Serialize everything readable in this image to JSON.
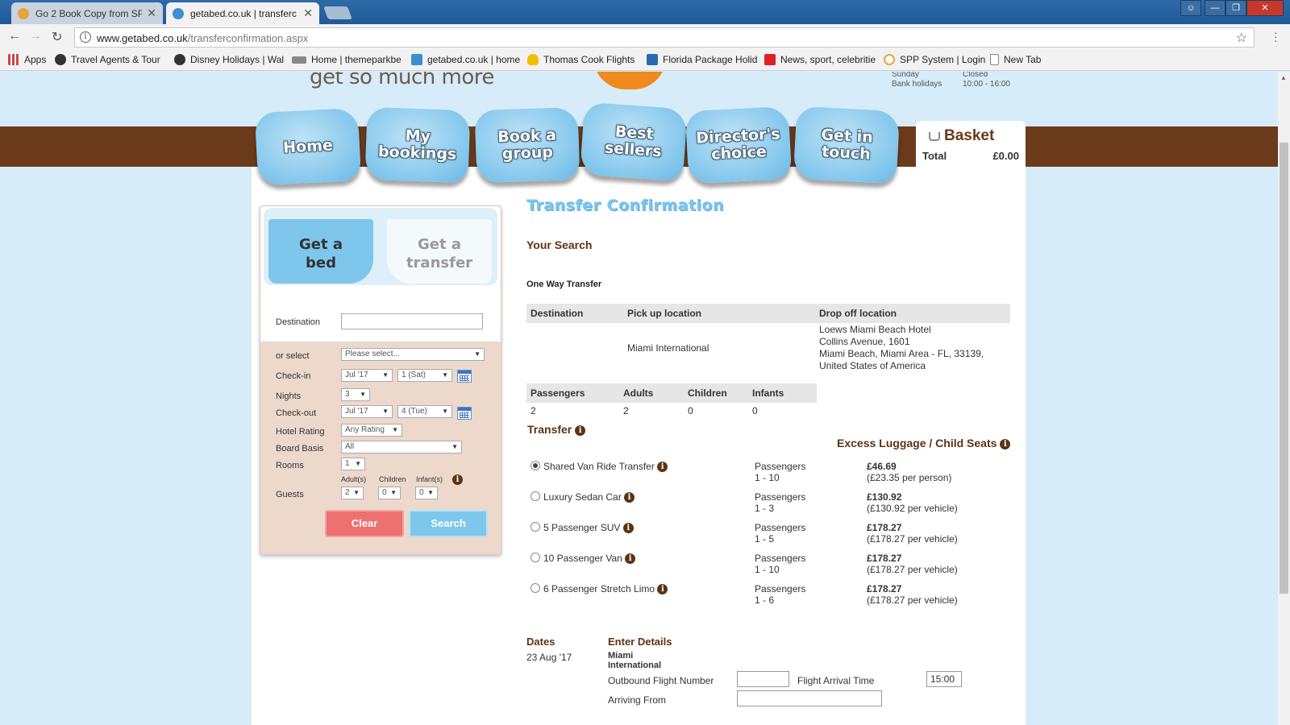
{
  "browser": {
    "tabs": [
      {
        "title": "Go 2 Book Copy from SP",
        "active": false,
        "favicon_color": "#e8a33d"
      },
      {
        "title": "getabed.co.uk | transferc",
        "active": true,
        "favicon_color": "#3d8fd0"
      }
    ],
    "address": {
      "domain": "www.getabed.co.uk",
      "path": "/transferconfirmation.aspx"
    },
    "bookmarks": [
      {
        "label": "Apps",
        "icon": "apps-grid-icon",
        "color": "#c44"
      },
      {
        "label": "Travel Agents & Tour",
        "icon": "mickey-icon",
        "color": "#333"
      },
      {
        "label": "Disney Holidays | Wal",
        "icon": "mickey-icon",
        "color": "#333"
      },
      {
        "label": "Home | themeparkbe",
        "icon": "tpb-logo-icon",
        "color": "#888"
      },
      {
        "label": "getabed.co.uk | home",
        "icon": "getabed-icon",
        "color": "#3d8fd0"
      },
      {
        "label": "Thomas Cook Flights",
        "icon": "heart-icon",
        "color": "#f0c000"
      },
      {
        "label": "Florida Package Holid",
        "icon": "plane-icon",
        "color": "#2a6ab0"
      },
      {
        "label": "News, sport, celebritie",
        "icon": "sun-s-icon",
        "color": "#d22"
      },
      {
        "label": "SPP System | Login",
        "icon": "globe-icon",
        "color": "#e8a33d"
      },
      {
        "label": "New Tab",
        "icon": "page-icon",
        "color": "#888"
      }
    ]
  },
  "site": {
    "tagline": "get so much more",
    "hours": [
      {
        "day": "Sunday",
        "time": "Closed"
      },
      {
        "day": "Bank holidays",
        "time": "10:00 - 16:00"
      }
    ],
    "nav": [
      {
        "line1": "Home",
        "line2": ""
      },
      {
        "line1": "My",
        "line2": "bookings"
      },
      {
        "line1": "Book a",
        "line2": "group"
      },
      {
        "line1": "Best",
        "line2": "sellers"
      },
      {
        "line1": "Director's",
        "line2": "choice"
      },
      {
        "line1": "Get in",
        "line2": "touch"
      }
    ],
    "basket": {
      "title": "Basket",
      "total_label": "Total",
      "total_value": "£0.00"
    }
  },
  "search_panel": {
    "tab_bed": {
      "line1": "Get a",
      "line2": "bed"
    },
    "tab_transfer": {
      "line1": "Get a",
      "line2": "transfer"
    },
    "destination_label": "Destination",
    "destination_value": "",
    "or_select_label": "or select",
    "or_select_value": "Please select...",
    "checkin_label": "Check-in",
    "checkin_month": "Jul '17",
    "checkin_day": "1 (Sat)",
    "nights_label": "Nights",
    "nights_value": "3",
    "checkout_label": "Check-out",
    "checkout_month": "Jul '17",
    "checkout_day": "4 (Tue)",
    "rating_label": "Hotel Rating",
    "rating_value": "Any Rating",
    "board_label": "Board Basis",
    "board_value": "All",
    "rooms_label": "Rooms",
    "rooms_value": "1",
    "adults_label": "Adult(s)",
    "children_label": "Children",
    "infants_label": "Infant(s)",
    "guests_label": "Guests",
    "adults_value": "2",
    "children_value": "0",
    "infants_value": "0",
    "clear_label": "Clear",
    "search_label": "Search"
  },
  "main": {
    "title": "Transfer Confirmation",
    "your_search": "Your Search",
    "trip_type": "One Way Transfer",
    "location_table": {
      "headers": [
        "Destination",
        "Pick up location",
        "Drop off location"
      ],
      "destination": "",
      "pickup": "Miami International",
      "dropoff_lines": [
        "Loews Miami Beach Hotel",
        "Collins Avenue, 1601",
        "Miami Beach, Miami Area - FL, 33139,",
        "United States of America"
      ]
    },
    "pax_table": {
      "headers": [
        "Passengers",
        "Adults",
        "Children",
        "Infants"
      ],
      "values": [
        "2",
        "2",
        "0",
        "0"
      ]
    },
    "transfer_heading": "Transfer",
    "excess_heading": "Excess Luggage / Child Seats",
    "transfers": [
      {
        "name": "Shared Van Ride Transfer",
        "selected": true,
        "pax_label": "Passengers",
        "pax_range": "1 - 10",
        "price": "£46.69",
        "unit": "(£23.35 per person)"
      },
      {
        "name": "Luxury Sedan Car",
        "selected": false,
        "pax_label": "Passengers",
        "pax_range": "1 - 3",
        "price": "£130.92",
        "unit": "(£130.92 per vehicle)"
      },
      {
        "name": "5 Passenger SUV",
        "selected": false,
        "pax_label": "Passengers",
        "pax_range": "1 - 5",
        "price": "£178.27",
        "unit": "(£178.27 per vehicle)"
      },
      {
        "name": "10 Passenger Van",
        "selected": false,
        "pax_label": "Passengers",
        "pax_range": "1 - 10",
        "price": "£178.27",
        "unit": "(£178.27 per vehicle)"
      },
      {
        "name": "6 Passenger Stretch Limo",
        "selected": false,
        "pax_label": "Passengers",
        "pax_range": "1 - 6",
        "price": "£178.27",
        "unit": "(£178.27 per vehicle)"
      }
    ],
    "dates_heading": "Dates",
    "date_value": "23 Aug '17",
    "enter_details_heading": "Enter Details",
    "airport_line1": "Miami",
    "airport_line2": "International",
    "outbound_label": "Outbound Flight Number",
    "outbound_value": "",
    "arrival_time_label": "Flight Arrival Time",
    "arrival_time_value": "15:00",
    "arriving_from_label": "Arriving From",
    "arriving_from_value": ""
  },
  "colors": {
    "brand_brown": "#6a3a1a",
    "accent_blue": "#7cc6ee",
    "clear_red": "#ee7170"
  }
}
